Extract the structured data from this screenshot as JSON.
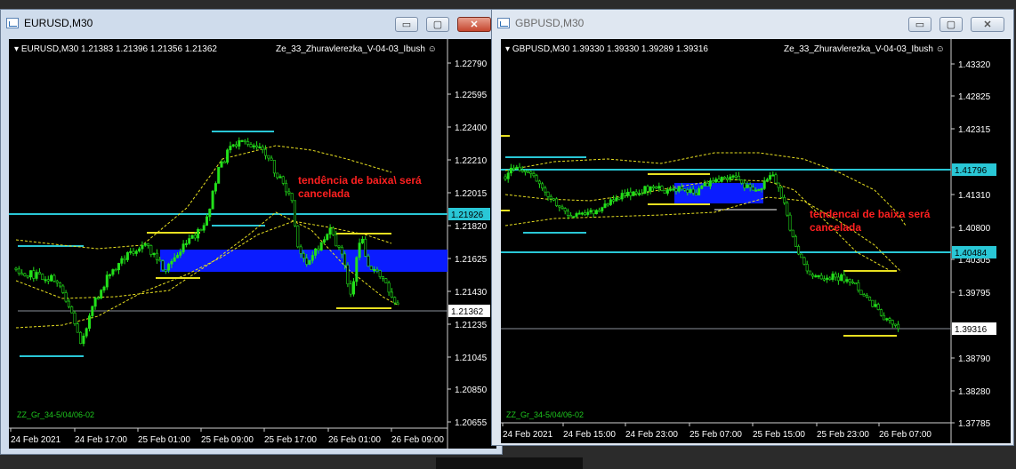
{
  "colors": {
    "candle": "#22e01a",
    "bands": "#e8e020",
    "level": "#29c7d6",
    "zone": "#0a1cff",
    "annot": "#ff2020"
  },
  "windows": [
    {
      "title": "EURUSD,M30",
      "header": "EURUSD,M30  1.21383 1.21396 1.21356 1.21362",
      "indicator": "Ze_33_Zhuravlerezka_V-04-03_Ibush",
      "zz_label": "ZZ_Gr_34-5/04/06-02",
      "annotation": [
        "tendência de baixa\\ será",
        "cancelada"
      ],
      "price_axis": [
        "1.22790",
        "1.22595",
        "1.22400",
        "1.22210",
        "1.22015",
        "1.21820",
        "1.21625",
        "1.21430",
        "1.21235",
        "1.21045",
        "1.20850",
        "1.20655"
      ],
      "price_badges": {
        "level": "1.21926",
        "current": "1.21362"
      },
      "time_axis": [
        "24 Feb 2021",
        "24 Feb 17:00",
        "25 Feb 01:00",
        "25 Feb 09:00",
        "25 Feb 17:00",
        "26 Feb 01:00",
        "26 Feb 09:00"
      ],
      "icons": {
        "app": "chart-window-icon",
        "minimize": "minimize-icon",
        "maximize": "maximize-icon",
        "close": "close-icon"
      },
      "buttons": {
        "minimize": "▭",
        "maximize": "▢",
        "close": "✕"
      }
    },
    {
      "title": "GBPUSD,M30",
      "header": "GBPUSD,M30  1.39330 1.39330 1.39289 1.39316",
      "indicator": "Ze_33_Zhuravlerezka_V-04-03_Ibush",
      "zz_label": "ZZ_Gr_34-5/04/06-02",
      "annotation": [
        "tendencai de baixa será",
        "cancelada"
      ],
      "price_axis": [
        "1.43320",
        "1.42825",
        "1.42315",
        "1.41310",
        "1.40800",
        "1.40305",
        "1.39795",
        "1.38790",
        "1.38280",
        "1.37785"
      ],
      "price_badges": {
        "level_top": "1.41796",
        "level": "1.40484",
        "current": "1.39316"
      },
      "time_axis": [
        "24 Feb 2021",
        "24 Feb 15:00",
        "24 Feb 23:00",
        "25 Feb 07:00",
        "25 Feb 15:00",
        "25 Feb 23:00",
        "26 Feb 07:00"
      ],
      "buttons": {
        "minimize": "▭",
        "maximize": "▢",
        "close": "✕"
      }
    }
  ]
}
